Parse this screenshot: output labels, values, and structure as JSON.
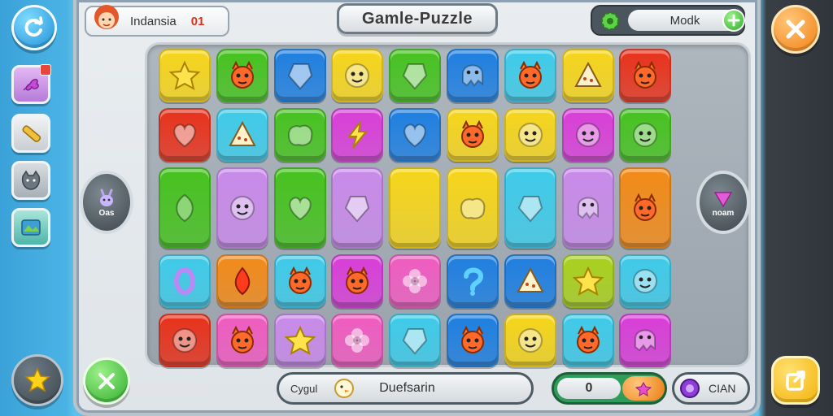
{
  "header": {
    "player_name": "Indansia",
    "player_level": "01",
    "title": "Gamle-Puzzle",
    "mode_label": "Modk"
  },
  "side": {
    "left_label": "Oas",
    "right_label": "noam"
  },
  "footer": {
    "search_label": "Cygul",
    "search_value": "Duefsarin",
    "counter_value": "0",
    "coin_label": "CIAN"
  },
  "colors": {
    "yellow": "#f6d51a",
    "green": "#46c21f",
    "blue": "#1f7fe0",
    "cyan": "#3ecbe9",
    "red": "#e8321b",
    "orange": "#f28a18",
    "magenta": "#d93ed8",
    "lilac": "#c88ae9",
    "pink": "#f05cc0",
    "lime": "#a9d11d"
  },
  "grid": [
    [
      {
        "color": "yellow",
        "icon": "star"
      },
      {
        "color": "green",
        "icon": "creature"
      },
      {
        "color": "blue",
        "icon": "gem"
      },
      {
        "color": "yellow",
        "icon": "face"
      },
      {
        "color": "green",
        "icon": "gem"
      },
      {
        "color": "blue",
        "icon": "squid"
      },
      {
        "color": "cyan",
        "icon": "creature"
      },
      {
        "color": "yellow",
        "icon": "triangle"
      },
      {
        "color": "red",
        "icon": "creature"
      }
    ],
    [
      {
        "color": "red",
        "icon": "heart"
      },
      {
        "color": "cyan",
        "icon": "triangle"
      },
      {
        "color": "green",
        "icon": "blob"
      },
      {
        "color": "magenta",
        "icon": "bolt"
      },
      {
        "color": "blue",
        "icon": "heart"
      },
      {
        "color": "yellow",
        "icon": "creature"
      },
      {
        "color": "yellow",
        "icon": "face"
      },
      {
        "color": "magenta",
        "icon": "face"
      },
      {
        "color": "green",
        "icon": "face"
      }
    ],
    [
      {
        "color": "green",
        "icon": "leaf"
      },
      {
        "color": "lilac",
        "icon": "face"
      },
      {
        "color": "green",
        "icon": "heart"
      },
      {
        "color": "lilac",
        "icon": "gem"
      },
      {
        "color": "yellow",
        "icon": "none"
      },
      {
        "color": "yellow",
        "icon": "blob"
      },
      {
        "color": "cyan",
        "icon": "gem"
      },
      {
        "color": "lilac",
        "icon": "squid"
      },
      {
        "color": "orange",
        "icon": "creature"
      }
    ],
    [
      {
        "color": "cyan",
        "icon": "ring"
      },
      {
        "color": "orange",
        "icon": "drop"
      },
      {
        "color": "cyan",
        "icon": "creature"
      },
      {
        "color": "magenta",
        "icon": "creature"
      },
      {
        "color": "pink",
        "icon": "flower"
      },
      {
        "color": "blue",
        "icon": "hook"
      },
      {
        "color": "blue",
        "icon": "triangle"
      },
      {
        "color": "lime",
        "icon": "star"
      },
      {
        "color": "cyan",
        "icon": "face"
      }
    ],
    [
      {
        "color": "red",
        "icon": "face"
      },
      {
        "color": "pink",
        "icon": "creature"
      },
      {
        "color": "lilac",
        "icon": "star"
      },
      {
        "color": "pink",
        "icon": "flower"
      },
      {
        "color": "cyan",
        "icon": "gem"
      },
      {
        "color": "blue",
        "icon": "creature"
      },
      {
        "color": "yellow",
        "icon": "face"
      },
      {
        "color": "cyan",
        "icon": "creature"
      },
      {
        "color": "magenta",
        "icon": "squid"
      }
    ]
  ]
}
